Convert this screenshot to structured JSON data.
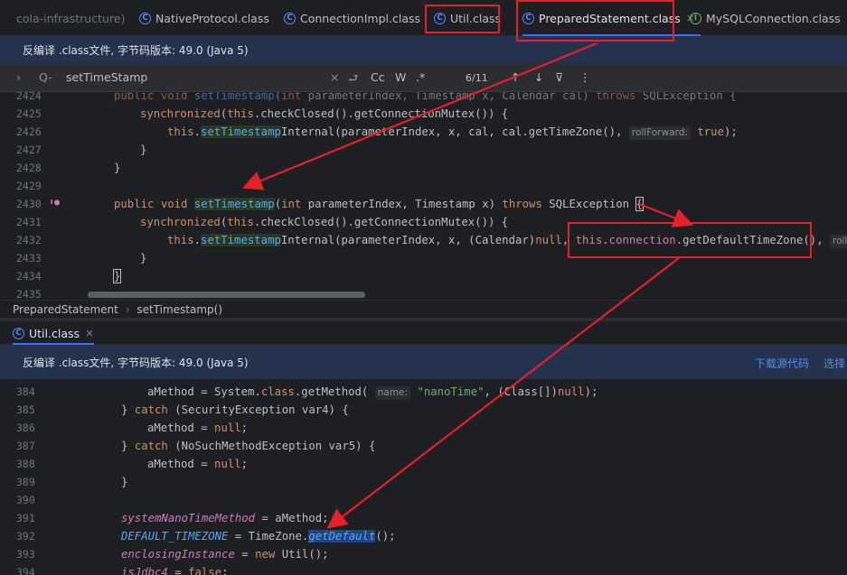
{
  "tabs": [
    {
      "label": "cola-infrastructure)",
      "icon": ""
    },
    {
      "label": "NativeProtocol.class",
      "icon": "class-icon"
    },
    {
      "label": "ConnectionImpl.class",
      "icon": "class-icon"
    },
    {
      "label": "Util.class",
      "icon": "class-icon"
    },
    {
      "label": "PreparedStatement.class",
      "icon": "class-icon",
      "close": "×"
    },
    {
      "label": "MySQLConnection.class",
      "icon": "interface-icon"
    }
  ],
  "infobar_top": {
    "text": "反编译 .class文件, 字节码版本: 49.0 (Java 5)"
  },
  "find": {
    "expand": "›",
    "search_icon": "Q-",
    "query": "setTimeStamp",
    "clear": "×",
    "match_case": "Cc",
    "words": "W",
    "regex": ".*",
    "count": "6/11",
    "up": "↑",
    "down": "↓",
    "filter": "⊽",
    "more": "⋮"
  },
  "editor_top": {
    "lines": [
      "2424",
      "2425",
      "2426",
      "2427",
      "2428",
      "2429",
      "2430",
      "2431",
      "2432",
      "2433",
      "2434",
      "2435"
    ]
  },
  "breadcrumb": {
    "class": "PreparedStatement",
    "sep": "›",
    "method": "setTimestamp()"
  },
  "tab2": {
    "label": "Util.class",
    "close": "×"
  },
  "infobar_bottom": {
    "text": "反编译 .class文件, 字节码版本: 49.0 (Java 5)",
    "download": "下载源代码",
    "choose": "选择"
  },
  "editor_bottom": {
    "lines": [
      "384",
      "385",
      "386",
      "387",
      "388",
      "389",
      "390",
      "391",
      "392",
      "393",
      "394"
    ]
  },
  "hints": {
    "rollForward": "rollForward:",
    "rollF": "rollF",
    "name": "name:"
  },
  "colors": {
    "annotation": "#e4202b",
    "accent": "#3574f0"
  }
}
